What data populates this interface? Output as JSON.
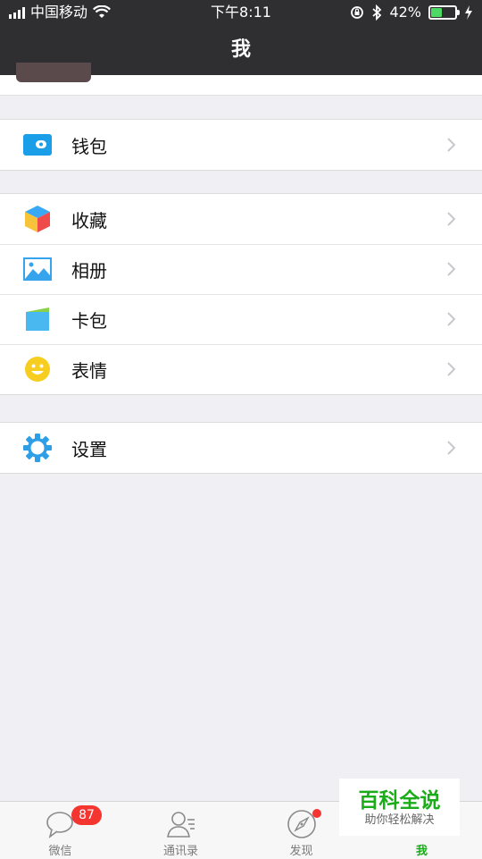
{
  "status_bar": {
    "carrier": "中国移动",
    "time": "下午8:11",
    "battery": "42%"
  },
  "nav": {
    "title": "我"
  },
  "menu": {
    "wallet": "钱包",
    "favorites": "收藏",
    "album": "相册",
    "cards": "卡包",
    "stickers": "表情",
    "settings": "设置"
  },
  "tabbar": {
    "chats": {
      "label": "微信",
      "badge": "87"
    },
    "contacts": {
      "label": "通讯录"
    },
    "discover": {
      "label": "发现"
    },
    "me": {
      "label": "我"
    }
  },
  "watermark": {
    "title": "百科全说",
    "subtitle": "助你轻松解决"
  },
  "colors": {
    "accent": "#1aad19",
    "badge": "#f43530",
    "nav_bg": "#2f2f31"
  }
}
